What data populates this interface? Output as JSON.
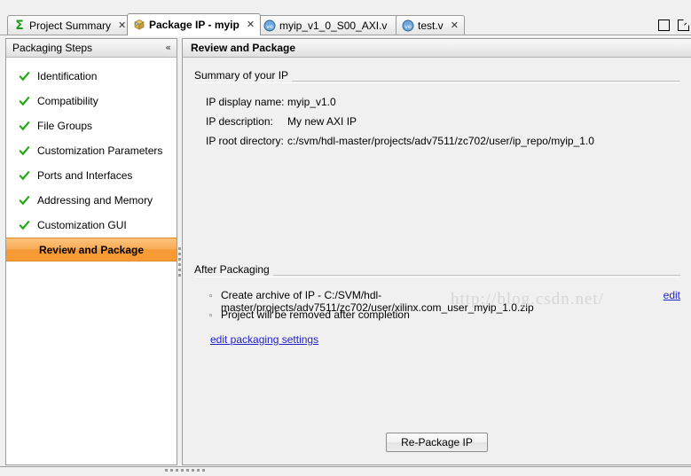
{
  "window": {
    "chrome_buttons": [
      {
        "name": "maximize-restore",
        "icon": "square-icon"
      },
      {
        "name": "float-window",
        "icon": "float-icon"
      }
    ]
  },
  "tabs": [
    {
      "label": "Project Summary",
      "icon": "sigma-icon",
      "active": false,
      "closable": true,
      "close_label": "✕"
    },
    {
      "label": "Package IP - myip",
      "icon": "package-icon",
      "active": true,
      "closable": true,
      "close_label": "✕"
    },
    {
      "label": "myip_v1_0_S00_AXI.v",
      "icon": "verilog-icon",
      "active": false,
      "closable": true,
      "close_label": "✕"
    },
    {
      "label": "test.v",
      "icon": "verilog-icon",
      "active": false,
      "closable": true,
      "close_label": "✕"
    }
  ],
  "sidebar": {
    "title": "Packaging Steps",
    "collapse_label": "«",
    "items": [
      {
        "label": "Identification",
        "done": true,
        "selected": false
      },
      {
        "label": "Compatibility",
        "done": true,
        "selected": false
      },
      {
        "label": "File Groups",
        "done": true,
        "selected": false
      },
      {
        "label": "Customization Parameters",
        "done": true,
        "selected": false
      },
      {
        "label": "Ports and Interfaces",
        "done": true,
        "selected": false
      },
      {
        "label": "Addressing and Memory",
        "done": true,
        "selected": false
      },
      {
        "label": "Customization GUI",
        "done": true,
        "selected": false
      },
      {
        "label": "Review and Package",
        "done": false,
        "selected": true
      }
    ]
  },
  "content": {
    "title": "Review and Package",
    "summary": {
      "heading": "Summary of your IP",
      "rows": [
        {
          "label": "IP display name:",
          "value": "myip_v1.0"
        },
        {
          "label": "IP description:",
          "value": "My new AXI IP"
        },
        {
          "label": "IP root directory:",
          "value": "c:/svm/hdl-master/projects/adv7511/zc702/user/ip_repo/myip_1.0"
        }
      ]
    },
    "after_packaging": {
      "heading": "After Packaging",
      "bullet_marker": "◦",
      "items": [
        {
          "text": "Create archive of IP - C:/SVM/hdl-master/projects/adv7511/zc702/user/xilinx.com_user_myip_1.0.zip",
          "link_label": "edit"
        },
        {
          "text": "Project will be removed after completion",
          "link_label": ""
        }
      ],
      "settings_link": "edit packaging settings"
    },
    "repackage_button": "Re-Package IP"
  },
  "watermark": "http://blog.csdn.net/",
  "colors": {
    "selected_step": "#f79a33",
    "check_green": "#1faa12",
    "link_blue": "#2222cc",
    "panel_bg": "#f0f0f0",
    "watermark_gray": "#d6d6d6"
  }
}
